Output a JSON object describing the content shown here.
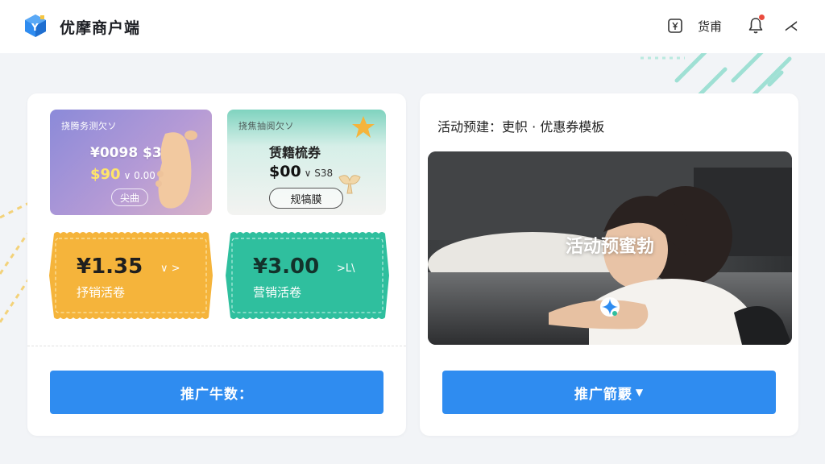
{
  "header": {
    "app_title": "优摩商户端",
    "account_label": "货甫",
    "wallet_icon": "wallet-icon",
    "bell_icon": "bell-icon",
    "collapse_icon": "collapse-icon",
    "collapse_glyph": "⋌"
  },
  "left_panel": {
    "template_cards": [
      {
        "tag": "挠腾务测欠ソ",
        "line1": "¥0098 $33",
        "line2": "$90",
        "line2_small": "∨ 0.00",
        "button": "尖曲"
      },
      {
        "tag": "挠焦抽阅欠ソ",
        "name": "赁籍梳券",
        "price": "$00",
        "price_small": "∨ S38",
        "button": "规犒膜"
      }
    ],
    "coupons": [
      {
        "amount": "¥1.35",
        "arrow": "∨ >",
        "label": "抒销活卷",
        "color": "#f5b43b"
      },
      {
        "amount": "¥3.00",
        "arrow": ">L\\",
        "label": "营销活卷",
        "color": "#2fbf9e"
      }
    ],
    "action_button": "推广牛数："
  },
  "right_panel": {
    "heading": "活动预建：吏帜 · 优惠券模板",
    "photo_overlay": "活动预蜜勃",
    "action_button": "推广箭覈",
    "action_caret": "▼"
  },
  "colors": {
    "primary": "#2f8cf0",
    "coupon_orange": "#f5b43b",
    "coupon_teal": "#2fbf9e",
    "notification": "#ea4b3d"
  }
}
